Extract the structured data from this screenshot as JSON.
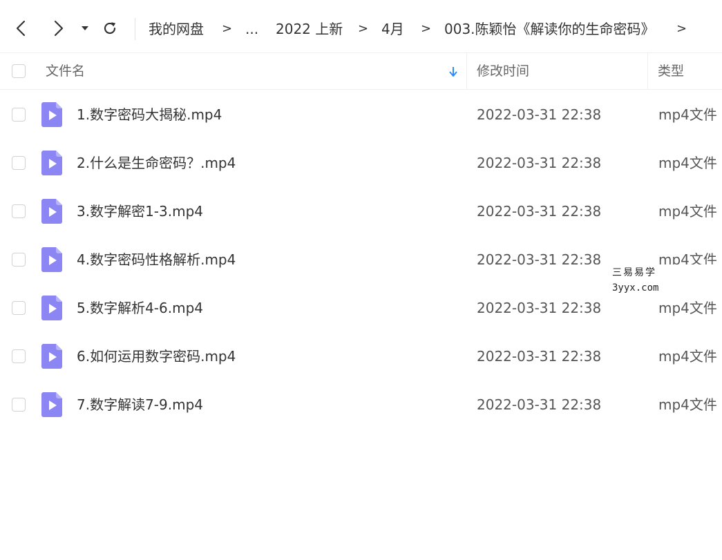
{
  "toolbar": {
    "back_icon": "chevron-left-icon",
    "forward_icon": "chevron-right-icon",
    "history_dropdown_icon": "caret-down-icon",
    "refresh_icon": "refresh-icon"
  },
  "breadcrumb": {
    "items": [
      {
        "label": "我的网盘"
      },
      {
        "label": "..."
      },
      {
        "label": "2022 上新"
      },
      {
        "label": "4月"
      },
      {
        "label": "003.陈颖怡《解读你的生命密码》"
      }
    ],
    "separator": ">"
  },
  "table": {
    "columns": {
      "name": "文件名",
      "modified": "修改时间",
      "type": "类型"
    },
    "sort_icon": "arrow-down-icon",
    "accent": "#2b8ff5",
    "file_icon_color": "#8c86f5",
    "rows": [
      {
        "name": "1.数字密码大揭秘.mp4",
        "modified": "2022-03-31 22:38",
        "type": "mp4文件"
      },
      {
        "name": "2.什么是生命密码？.mp4",
        "modified": "2022-03-31 22:38",
        "type": "mp4文件"
      },
      {
        "name": "3.数字解密1-3.mp4",
        "modified": "2022-03-31 22:38",
        "type": "mp4文件"
      },
      {
        "name": "4.数字密码性格解析.mp4",
        "modified": "2022-03-31 22:38",
        "type": "mp4文件"
      },
      {
        "name": "5.数字解析4-6.mp4",
        "modified": "2022-03-31 22:38",
        "type": "mp4文件"
      },
      {
        "name": "6.如何运用数字密码.mp4",
        "modified": "2022-03-31 22:38",
        "type": "mp4文件"
      },
      {
        "name": "7.数字解读7-9.mp4",
        "modified": "2022-03-31 22:38",
        "type": "mp4文件"
      }
    ]
  },
  "watermark": {
    "line1": "三易易学",
    "line2": "3yyx.com"
  }
}
